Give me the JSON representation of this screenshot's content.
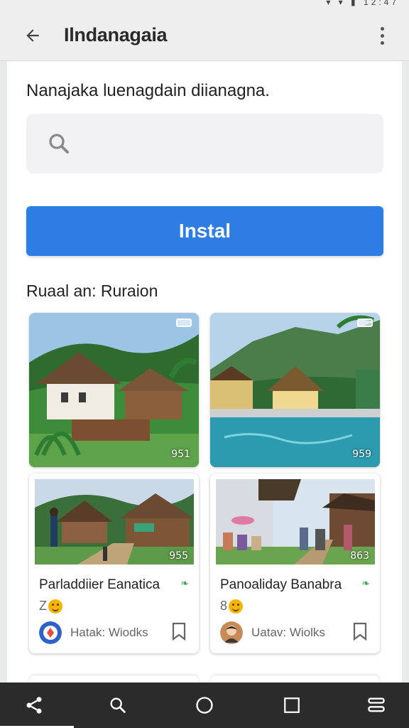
{
  "status_bar": {
    "icons": "▾ ▾ ▮ 12:47"
  },
  "app_bar": {
    "title": "Ilndanagaia",
    "back_icon": "arrow-left-icon",
    "menu_icon": "more-vert-icon"
  },
  "prompt": "Nanajaka luenagdain diianagna.",
  "search": {
    "placeholder": "",
    "icon": "search-icon"
  },
  "install_button": {
    "label": "Instal",
    "color": "#2d7de5"
  },
  "section_title": "Ruaal an: Ruraion",
  "photos": [
    {
      "name": "photo-traditional-houses",
      "count": "951"
    },
    {
      "name": "photo-resort-pool",
      "count": "959"
    }
  ],
  "cards": [
    {
      "title": "Parladdiier Eanatica",
      "rating": "Z",
      "tag": "❧",
      "author": "Hatak: Wiodks",
      "image_count": "955"
    },
    {
      "title": "Panoaliday Banabra",
      "rating": "8",
      "tag": "❧",
      "author": "Uatav: Wiolks",
      "image_count": "863"
    }
  ],
  "nav_bar": {
    "items": [
      "share-icon",
      "search-icon",
      "home-circle-icon",
      "recents-square-icon",
      "menu-lines-icon"
    ]
  },
  "colors": {
    "accent": "#2d7de5",
    "tag_green": "#3aa655",
    "nav_bg": "#2b2b2b"
  }
}
